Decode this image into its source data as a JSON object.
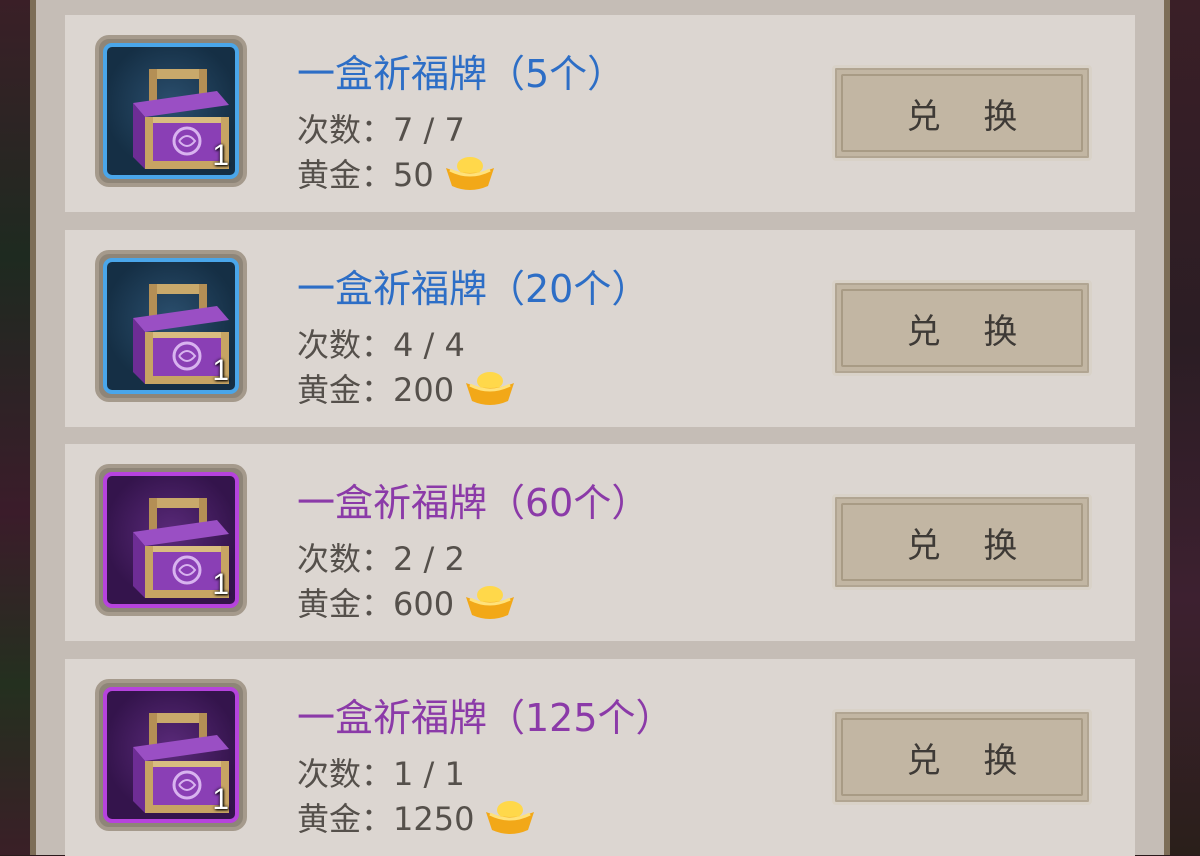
{
  "rows": [
    {
      "title": "一盒祈福牌（5个）",
      "title_color": "blue",
      "icon": "purple-chest-icon",
      "icon_frame": "blue",
      "item_count": "1",
      "count_text": "次数：7 / 7",
      "gold_text": "黄金：50",
      "button_label": "兑 换"
    },
    {
      "title": "一盒祈福牌（20个）",
      "title_color": "blue",
      "icon": "purple-chest-icon",
      "icon_frame": "blue",
      "item_count": "1",
      "count_text": "次数：4 / 4",
      "gold_text": "黄金：200",
      "button_label": "兑 换"
    },
    {
      "title": "一盒祈福牌（60个）",
      "title_color": "purple",
      "icon": "purple-chest-icon",
      "icon_frame": "purple",
      "item_count": "1",
      "count_text": "次数：2 / 2",
      "gold_text": "黄金：600",
      "button_label": "兑 换"
    },
    {
      "title": "一盒祈福牌（125个）",
      "title_color": "purple",
      "icon": "purple-chest-icon",
      "icon_frame": "purple",
      "item_count": "1",
      "count_text": "次数：1 / 1",
      "gold_text": "黄金：1250",
      "button_label": "兑 换"
    }
  ],
  "colors": {
    "blue_title": "#2d6ec6",
    "purple_title": "#8b3aa8",
    "row_bg": "#dcd6d1",
    "button_bg": "#c2b6a3"
  }
}
